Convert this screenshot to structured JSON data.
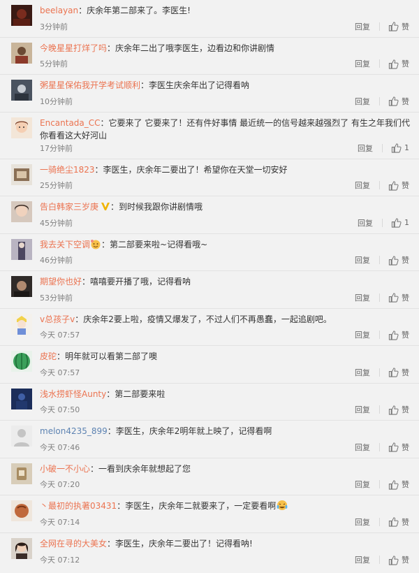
{
  "labels": {
    "reply": "回复"
  },
  "colors": {
    "username": "#eb7350",
    "username_alt": "#5d83b2",
    "time": "#808080"
  },
  "comments": [
    {
      "user": "beelayan",
      "text": "：庆余年第二部来了。李医生!",
      "time": "3分钟前",
      "like": "赞"
    },
    {
      "user": "今晚星星打烊了吗",
      "text": "：庆余年二出了哦李医生，边看边和你讲剧情",
      "time": "5分钟前",
      "like": "赞"
    },
    {
      "user": "粥星星保佑我开学考试顺利",
      "text": "：李医生庆余年出了记得看呐",
      "time": "10分钟前",
      "like": "赞"
    },
    {
      "user": "Encantada_CC",
      "text": "：它要来了 它要来了！还有件好事情 最近统一的信号越来越强烈了 有生之年我们代你看看这大好河山",
      "time": "17分钟前",
      "like": "1"
    },
    {
      "user": "一骑绝尘1823",
      "text": "：李医生，庆余年二要出了！希望你在天堂一切安好",
      "time": "25分钟前",
      "like": "赞"
    },
    {
      "user": "告白韩家三岁庚",
      "text": "：到时候我跟你讲剧情哦",
      "time": "45分钟前",
      "like": "1"
    },
    {
      "user": "我去关下空调",
      "text": "：第二部要来啦~记得看哦~",
      "time": "46分钟前",
      "like": "赞"
    },
    {
      "user": "期望你也好",
      "text": "：嘻嘻要开播了哦，记得看呐",
      "time": "53分钟前",
      "like": "赞"
    },
    {
      "user": "v总孩子v",
      "text": "：庆余年2要上啦，疫情又爆发了，不过人们不再愚蠢，一起追剧吧。",
      "time": "今天 07:57",
      "like": "赞"
    },
    {
      "user": "皮砣",
      "text": "：明年就可以看第二部了噢",
      "time": "今天 07:57",
      "like": "赞"
    },
    {
      "user": "浅水捞虾怪Aunty",
      "text": "：第二部要来啦",
      "time": "今天 07:50",
      "like": "赞"
    },
    {
      "user": "melon4235_899",
      "text": "：李医生，庆余年2明年就上映了，记得看啊",
      "time": "今天 07:46",
      "like": "赞"
    },
    {
      "user": "小破一不小心",
      "text": "：一看到庆余年就想起了您",
      "time": "今天 07:20",
      "like": "赞"
    },
    {
      "user": "丶最初的执著03431",
      "text": "：李医生，庆余年二就要来了，一定要看啊",
      "time": "今天 07:14",
      "like": "赞"
    },
    {
      "user": "全网在寻的大美女",
      "text": "：李医生，庆余年二要出了！记得看呐!",
      "time": "今天 07:12",
      "like": "赞"
    }
  ]
}
